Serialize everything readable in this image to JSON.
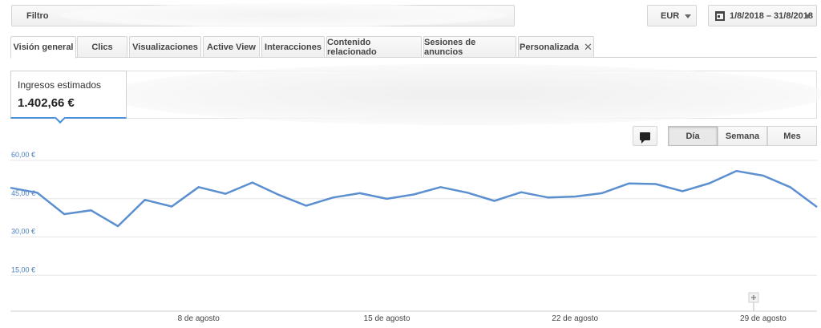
{
  "toolbar": {
    "filter_label": "Filtro",
    "currency": "EUR",
    "date_range": "1/8/2018 – 31/8/2018"
  },
  "tabs": [
    {
      "label": "Visión general",
      "active": true
    },
    {
      "label": "Clics",
      "active": false
    },
    {
      "label": "Visualizaciones",
      "active": false
    },
    {
      "label": "Active View",
      "active": false
    },
    {
      "label": "Interacciones",
      "active": false
    },
    {
      "label": "Contenido relacionado",
      "active": false
    },
    {
      "label": "Sesiones de anuncios",
      "active": false
    },
    {
      "label": "Personalizada",
      "active": false,
      "closable": true,
      "close_glyph": "✕"
    }
  ],
  "metric": {
    "label": "Ingresos estimados",
    "value": "1.402,66 €"
  },
  "granularity": {
    "options": [
      "Día",
      "Semana",
      "Mes"
    ],
    "selected": "Día"
  },
  "colors": {
    "line": "#5b8fd0",
    "accent": "#4a90d9",
    "grid": "#e6e6e6"
  },
  "chart_data": {
    "type": "line",
    "x": [
      "2018-08-01",
      "2018-08-02",
      "2018-08-03",
      "2018-08-04",
      "2018-08-05",
      "2018-08-06",
      "2018-08-07",
      "2018-08-08",
      "2018-08-09",
      "2018-08-10",
      "2018-08-11",
      "2018-08-12",
      "2018-08-13",
      "2018-08-14",
      "2018-08-15",
      "2018-08-16",
      "2018-08-17",
      "2018-08-18",
      "2018-08-19",
      "2018-08-20",
      "2018-08-21",
      "2018-08-22",
      "2018-08-23",
      "2018-08-24",
      "2018-08-25",
      "2018-08-26",
      "2018-08-27",
      "2018-08-28",
      "2018-08-29",
      "2018-08-30",
      "2018-08-31"
    ],
    "series": [
      {
        "values": [
          48.3,
          46.4,
          38.0,
          39.5,
          33.3,
          43.6,
          41.0,
          48.6,
          46.0,
          50.4,
          45.5,
          41.3,
          44.5,
          46.2,
          44.0,
          45.7,
          48.6,
          46.4,
          43.2,
          46.6,
          44.5,
          44.9,
          46.2,
          50.0,
          49.8,
          47.0,
          50.1,
          54.9,
          53.1,
          48.6,
          40.8
        ]
      }
    ],
    "ylim": [
      0,
      60
    ],
    "y_ticks": [
      "60,00 €",
      "45,00 €",
      "30,00 €",
      "15,00 €"
    ],
    "y_tick_values": [
      60,
      45,
      30,
      15
    ],
    "x_ticks": [
      "8 de agosto",
      "15 de agosto",
      "22 de agosto",
      "29 de agosto"
    ],
    "x_tick_dates": [
      "2018-08-08",
      "2018-08-15",
      "2018-08-22",
      "2018-08-29"
    ],
    "grid": true
  }
}
